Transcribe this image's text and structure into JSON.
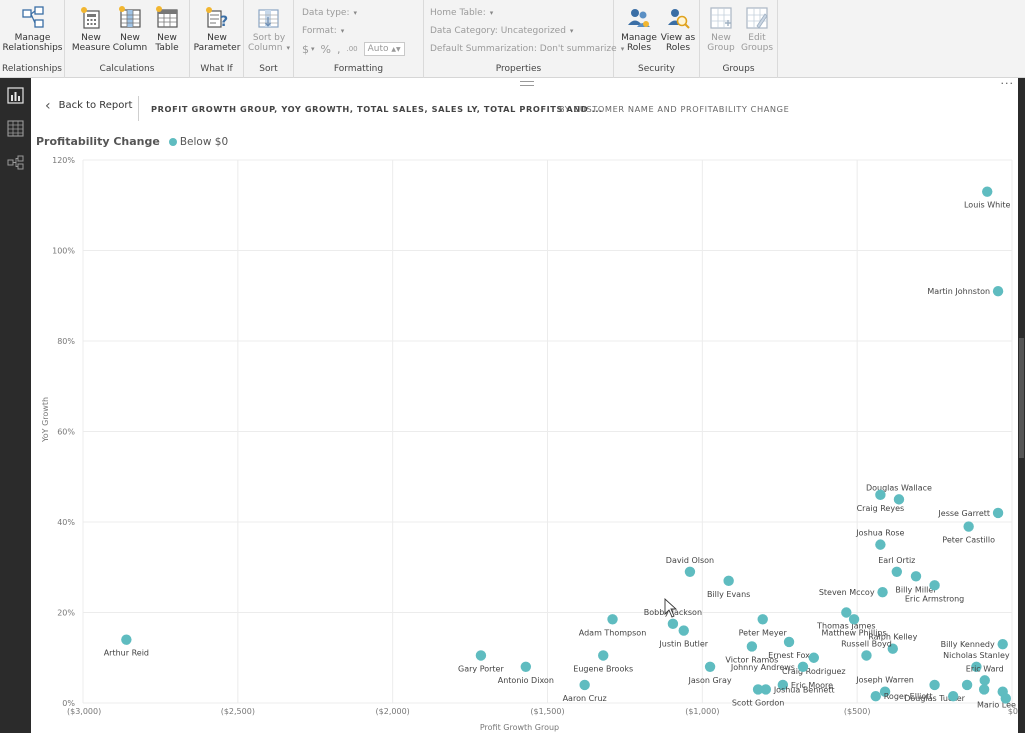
{
  "ribbon": {
    "relationships": {
      "manage_label": "Manage\nRelationships",
      "group": "Relationships"
    },
    "calculations": {
      "new_measure": "New\nMeasure",
      "new_column": "New\nColumn",
      "new_table": "New\nTable",
      "group": "Calculations"
    },
    "whatif": {
      "new_parameter": "New\nParameter",
      "group": "What If"
    },
    "sort": {
      "sort_by_column": "Sort by\nColumn",
      "group": "Sort"
    },
    "formatting": {
      "data_type": "Data type:",
      "format": "Format:",
      "dollar": "$",
      "percent": "%",
      "comma": ",",
      "decimals_icon": ".00",
      "auto": "Auto",
      "group": "Formatting"
    },
    "properties": {
      "home_table": "Home Table:",
      "data_category": "Data Category: Uncategorized",
      "default_summarization": "Default Summarization: Don't summarize",
      "group": "Properties"
    },
    "security": {
      "manage_roles": "Manage\nRoles",
      "view_as_roles": "View as\nRoles",
      "group": "Security"
    },
    "groups": {
      "new_group": "New\nGroup",
      "edit_groups": "Edit\nGroups",
      "group": "Groups"
    }
  },
  "rail": {
    "icons": [
      "report-view-icon",
      "data-view-icon",
      "relationships-view-icon"
    ]
  },
  "canvas": {
    "more": "···"
  },
  "backbar": {
    "back_label": "Back to Report",
    "crumb_primary": "PROFIT GROWTH GROUP, YOY GROWTH, TOTAL SALES, SALES LY, TOTAL PROFITS AND ...",
    "crumb_secondary": "BY CUSTOMER NAME AND PROFITABILITY CHANGE"
  },
  "legend": {
    "title": "Profitability Change",
    "item": "Below $0",
    "color": "#5fbcc0"
  },
  "chart_data": {
    "type": "scatter",
    "xlabel": "Profit Growth Group",
    "ylabel": "YoY Growth",
    "xlim": [
      -3000,
      0
    ],
    "ylim": [
      0,
      120
    ],
    "x_ticks": [
      {
        "v": -3000,
        "label": "($3,000)"
      },
      {
        "v": -2500,
        "label": "($2,500)"
      },
      {
        "v": -2000,
        "label": "($2,000)"
      },
      {
        "v": -1500,
        "label": "($1,500)"
      },
      {
        "v": -1000,
        "label": "($1,000)"
      },
      {
        "v": -500,
        "label": "($500)"
      },
      {
        "v": 0,
        "label": "$0"
      }
    ],
    "y_ticks": [
      {
        "v": 0,
        "label": "0%"
      },
      {
        "v": 20,
        "label": "20%"
      },
      {
        "v": 40,
        "label": "40%"
      },
      {
        "v": 60,
        "label": "60%"
      },
      {
        "v": 80,
        "label": "80%"
      },
      {
        "v": 100,
        "label": "100%"
      },
      {
        "v": 120,
        "label": "120%"
      }
    ],
    "grid": true,
    "point_color": "#5fbcc0",
    "points": [
      {
        "name": "Louis White",
        "x": -80,
        "y": 113,
        "label_pos": "below"
      },
      {
        "name": "Martin Johnston",
        "x": -45,
        "y": 91,
        "label_pos": "left"
      },
      {
        "name": "Douglas Wallace",
        "x": -365,
        "y": 45,
        "label_pos": "above"
      },
      {
        "name": "Craig Reyes",
        "x": -425,
        "y": 46,
        "label_pos": "below"
      },
      {
        "name": "Jesse Garrett",
        "x": -45,
        "y": 42,
        "label_pos": "left"
      },
      {
        "name": "Peter Castillo",
        "x": -140,
        "y": 39,
        "label_pos": "below"
      },
      {
        "name": "Joshua Rose",
        "x": -425,
        "y": 35,
        "label_pos": "above"
      },
      {
        "name": "Earl Ortiz",
        "x": -372,
        "y": 29,
        "label_pos": "above"
      },
      {
        "name": "David Olson",
        "x": -1040,
        "y": 29,
        "label_pos": "above"
      },
      {
        "name": "Billy Evans",
        "x": -915,
        "y": 27,
        "label_pos": "below"
      },
      {
        "name": "Billy Miller",
        "x": -310,
        "y": 28,
        "label_pos": "below"
      },
      {
        "name": "Eric Armstrong",
        "x": -250,
        "y": 26,
        "label_pos": "below"
      },
      {
        "name": "Steven Mccoy",
        "x": -418,
        "y": 24.5,
        "label_pos": "left"
      },
      {
        "name": "Thomas James",
        "x": -535,
        "y": 20,
        "label_pos": "below"
      },
      {
        "name": "Matthew Phillips",
        "x": -510,
        "y": 18.5,
        "label_pos": "below"
      },
      {
        "name": "Bobby Jackson",
        "x": -1095,
        "y": 17.5,
        "label_pos": "above"
      },
      {
        "name": "Justin Butler",
        "x": -1060,
        "y": 16,
        "label_pos": "below"
      },
      {
        "name": "Adam Thompson",
        "x": -1290,
        "y": 18.5,
        "label_pos": "below"
      },
      {
        "name": "Peter Meyer",
        "x": -805,
        "y": 18.5,
        "label_pos": "below"
      },
      {
        "name": "Ernest Fox",
        "x": -720,
        "y": 13.5,
        "label_pos": "below"
      },
      {
        "name": "Ralph Kelley",
        "x": -385,
        "y": 12,
        "label_pos": "above"
      },
      {
        "name": "Russell Boyd",
        "x": -470,
        "y": 10.5,
        "label_pos": "above"
      },
      {
        "name": "Billy Kennedy",
        "x": -30,
        "y": 13,
        "label_pos": "left"
      },
      {
        "name": "Victor Ramos",
        "x": -840,
        "y": 12.5,
        "label_pos": "below"
      },
      {
        "name": "Craig Rodriguez",
        "x": -640,
        "y": 10,
        "label_pos": "below"
      },
      {
        "name": "Johnny Andrews",
        "x": -675,
        "y": 8,
        "label_pos": "left"
      },
      {
        "name": "Nicholas Stanley",
        "x": -115,
        "y": 8,
        "label_pos": "above"
      },
      {
        "name": "Eric Ward",
        "x": -88,
        "y": 5,
        "label_pos": "above"
      },
      {
        "name": "Arthur Reid",
        "x": -2860,
        "y": 14,
        "label_pos": "below"
      },
      {
        "name": "Gary Porter",
        "x": -1715,
        "y": 10.5,
        "label_pos": "below"
      },
      {
        "name": "Antonio Dixon",
        "x": -1570,
        "y": 8,
        "label_pos": "below"
      },
      {
        "name": "Eugene Brooks",
        "x": -1320,
        "y": 10.5,
        "label_pos": "below"
      },
      {
        "name": "Jason Gray",
        "x": -975,
        "y": 8,
        "label_pos": "below"
      },
      {
        "name": "Aaron Cruz",
        "x": -1380,
        "y": 4,
        "label_pos": "below"
      },
      {
        "name": "Eric Moore",
        "x": -740,
        "y": 4,
        "label_pos": "right"
      },
      {
        "name": "Joshua Bennett",
        "x": -795,
        "y": 3,
        "label_pos": "right"
      },
      {
        "name": "Scott Gordon",
        "x": -820,
        "y": 3,
        "label_pos": "below"
      },
      {
        "name": "Joseph Warren",
        "x": -410,
        "y": 2.5,
        "label_pos": "above"
      },
      {
        "name": "Roger Elliott",
        "x": -440,
        "y": 1.5,
        "label_pos": "right"
      },
      {
        "name": "Douglas Tucker",
        "x": -250,
        "y": 4,
        "label_pos": "below"
      },
      {
        "name": "Mario Lee",
        "x": -30,
        "y": 2.5,
        "label_pos": "below"
      },
      {
        "name": "",
        "x": -145,
        "y": 4,
        "label_pos": "none"
      },
      {
        "name": "",
        "x": -90,
        "y": 3,
        "label_pos": "none"
      },
      {
        "name": "",
        "x": -190,
        "y": 1.5,
        "label_pos": "none"
      },
      {
        "name": "",
        "x": -20,
        "y": 1,
        "label_pos": "none"
      }
    ]
  }
}
